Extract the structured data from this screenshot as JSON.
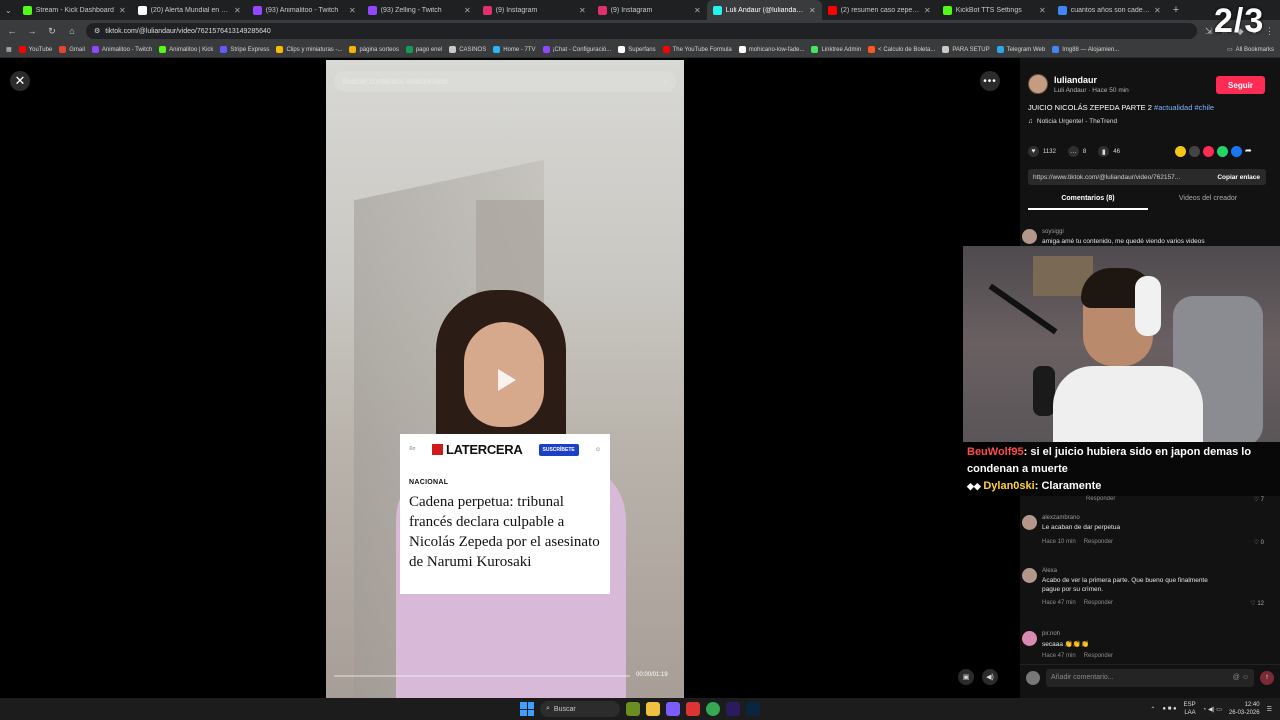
{
  "browser": {
    "tabs": [
      {
        "label": "Stream - Kick Dashboard",
        "color": "#53fc18"
      },
      {
        "label": "(20) Alerta Mundial en X: \"co",
        "color": "#ffffff"
      },
      {
        "label": "(93) Animalitoo - Twitch",
        "color": "#9146ff"
      },
      {
        "label": "(93) Zelling - Twitch",
        "color": "#9146ff"
      },
      {
        "label": "(9) Instagram",
        "color": "#e1306c"
      },
      {
        "label": "(9) Instagram",
        "color": "#e1306c"
      },
      {
        "label": "Luli Andaur (@luliandaur) | Ti",
        "color": "#25f4ee",
        "active": true
      },
      {
        "label": "(2) resumen caso zepeda y nu",
        "color": "#ff0000"
      },
      {
        "label": "KickBot TTS Settings",
        "color": "#53fc18"
      },
      {
        "label": "cuantos años son cadena per",
        "color": "#4285f4"
      }
    ],
    "url": "tiktok.com/@luliandaur/video/7621576413149285640",
    "bookmarks": [
      {
        "label": "YouTube",
        "color": "#ff0000"
      },
      {
        "label": "Gmail",
        "color": "#ea4335"
      },
      {
        "label": "Animalitoo - Twitch",
        "color": "#9146ff"
      },
      {
        "label": "Animalitoo | Kick",
        "color": "#53fc18"
      },
      {
        "label": "Stripe Express",
        "color": "#635bff"
      },
      {
        "label": "Clips y miniaturas -...",
        "color": "#fbbc05"
      },
      {
        "label": "página sorteos",
        "color": "#f4b400"
      },
      {
        "label": "pago enel",
        "color": "#0f9d58"
      },
      {
        "label": "CASINOS",
        "color": "#c9c9c9"
      },
      {
        "label": "Home - 7TV",
        "color": "#29b6f6"
      },
      {
        "label": "¡Chat - Configuració...",
        "color": "#9146ff"
      },
      {
        "label": "Superfans",
        "color": "#ffffff"
      },
      {
        "label": "The YouTube Formula",
        "color": "#ff0000"
      },
      {
        "label": "mohicano-low-fade...",
        "color": "#ffffff"
      },
      {
        "label": "Linktree Admin",
        "color": "#43e660"
      },
      {
        "label": "< Calculo de Boleta...",
        "color": "#ff5722"
      },
      {
        "label": "PARA SETUP",
        "color": "#c9c9c9"
      },
      {
        "label": "Telegram Web",
        "color": "#29a9eb"
      },
      {
        "label": "Img88 — Alojamien...",
        "color": "#4285f4"
      }
    ],
    "all_bookmarks": "All Bookmarks"
  },
  "video": {
    "search_placeholder": "Buscar contenido relacionado",
    "article": {
      "brand": "LATERCERA",
      "subscribe": "SUSCRÍBETE",
      "section": "NACIONAL",
      "title": "Cadena perpetua: tribunal francés declara culpable a Nicolás Zepeda por el asesinato de Narumi Kurosaki"
    },
    "time": "00:00/01:19"
  },
  "post": {
    "username": "luliandaur",
    "subtitle": "Luli Andaur · Hace 50 min",
    "follow": "Seguir",
    "desc": "JUICIO NICOLÁS ZEPEDA PARTE 2",
    "tags": "#actualidad #chile",
    "music": "Noticia Urgente! - TheTrend",
    "likes": "1132",
    "comments": "8",
    "saves": "46",
    "link": "https://www.tiktok.com/@luliandaur/video/762157...",
    "copy": "Copiar enlace",
    "tab_comments": "Comentarios (8)",
    "tab_videos": "Videos del creador"
  },
  "comments": [
    {
      "user": "soysiggi",
      "text": "amiga amé tu contenido, me quedé viendo varios videos"
    },
    {
      "user": "alexzambrano",
      "text": "Le acaban de dar perpetua",
      "meta": "Hace 10 min",
      "reply": "Responder",
      "likes": "0"
    },
    {
      "user": "Alexa",
      "text": "Acabo de ver la primera parte. Que bueno que finalmente",
      "text2": "pague por su crimen.",
      "meta": "Hace 47 min",
      "reply": "Responder",
      "likes": "12"
    },
    {
      "user": "pir.noh",
      "text": "secaaa 👏👏👏",
      "meta": "Hace 47 min",
      "reply": "Responder"
    }
  ],
  "hidden_comment_meta": {
    "reply": "Responder",
    "likes": "7"
  },
  "comment_input": "Añadir comentario...",
  "stream": {
    "counter": "2/3",
    "chat": [
      {
        "user": "BeuWolf95",
        "text": "si el juicio hubiera sido en japon demas lo condenan a muerte"
      },
      {
        "user": "Dylan0ski",
        "text": "Claramente"
      }
    ]
  },
  "taskbar": {
    "search": "Buscar",
    "lang1": "ESP",
    "lang2": "LAA",
    "time": "12:40",
    "date": "26-03-2026"
  }
}
